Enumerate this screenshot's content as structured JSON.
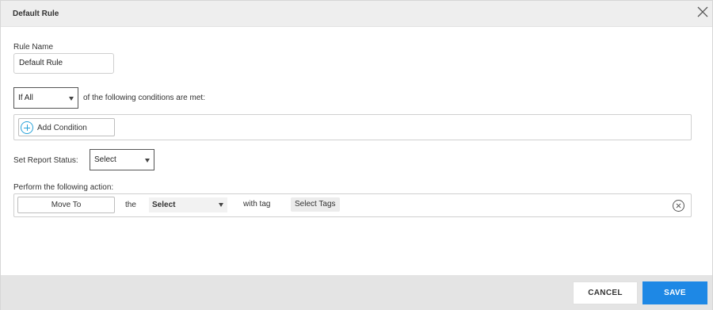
{
  "dialog": {
    "title": "Default Rule",
    "close_icon": "close-icon"
  },
  "rule_name": {
    "label": "Rule Name",
    "value": "Default Rule"
  },
  "condition_match": {
    "selected": "If All",
    "suffix": "of the following conditions are met:"
  },
  "conditions": {
    "add_label": "Add Condition",
    "add_icon": "plus-circle-icon"
  },
  "report_status": {
    "label": "Set Report Status:",
    "selected": "Select"
  },
  "action": {
    "label": "Perform the following action:",
    "action_button": "Move To",
    "the_text": "the",
    "target_selected": "Select",
    "with_tag_text": "with tag",
    "tags_placeholder": "Select Tags",
    "remove_icon": "remove-circle-icon"
  },
  "footer": {
    "cancel_label": "CANCEL",
    "save_label": "SAVE"
  },
  "colors": {
    "accent": "#1e88e5",
    "icon_blue": "#29a3d9",
    "header_bg": "#eeeeee",
    "footer_bg": "#e4e4e4"
  }
}
